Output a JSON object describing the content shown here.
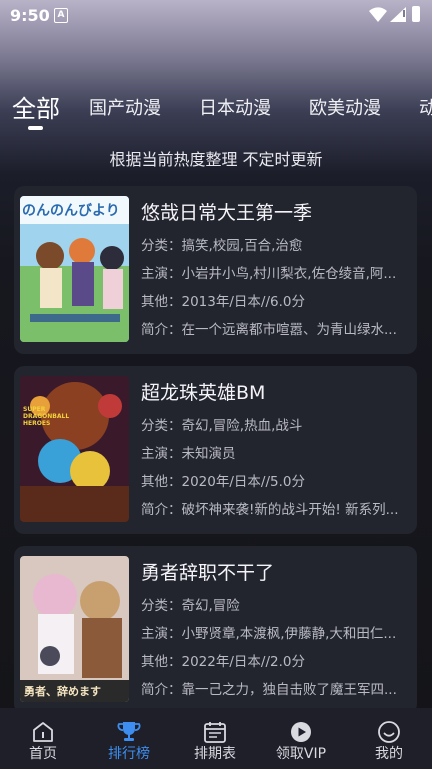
{
  "status": {
    "time": "9:50",
    "app_badge": "A"
  },
  "tabs": [
    "全部",
    "国产动漫",
    "日本动漫",
    "欧美动漫",
    "动"
  ],
  "subtitle": "根据当前热度整理 不定时更新",
  "colors": {
    "accent": "#3d8ef0",
    "card_bg": "#22242e",
    "nav_bg": "#1e1f28"
  },
  "labels": {
    "category": "分类：",
    "cast": "主演：",
    "other": "其他：",
    "intro": "简介："
  },
  "cards": [
    {
      "poster_text": "のんのんびより",
      "title": "悠哉日常大王第一季",
      "category": "搞笑,校园,百合,治愈",
      "cast": "小岩井小鸟,村川梨衣,佐仓绫音,阿...",
      "other": "2013年/日本//6.0分",
      "intro": "在一个远离都市喧嚣、为青山绿水..."
    },
    {
      "poster_text": "SUPER DRAGONBALL HEROES",
      "title": "超龙珠英雄BM",
      "category": "奇幻,冒险,热血,战斗",
      "cast": "未知演员",
      "other": "2020年/日本//5.0分",
      "intro": "破坏神来袭!新的战斗开始! 新系列..."
    },
    {
      "poster_text": "勇者、辞めます",
      "title": "勇者辞职不干了",
      "category": "奇幻,冒险",
      "cast": "小野贤章,本渡枫,伊藤静,大和田仁...",
      "other": "2022年/日本//2.0分",
      "intro": "靠一己之力，独自击败了魔王军四..."
    }
  ],
  "nav": [
    {
      "label": "首页",
      "icon": "home-icon",
      "active": false
    },
    {
      "label": "排行榜",
      "icon": "trophy-icon",
      "active": true
    },
    {
      "label": "排期表",
      "icon": "calendar-icon",
      "active": false
    },
    {
      "label": "领取VIP",
      "icon": "play-circle-icon",
      "active": false
    },
    {
      "label": "我的",
      "icon": "smiley-icon",
      "active": false
    }
  ]
}
